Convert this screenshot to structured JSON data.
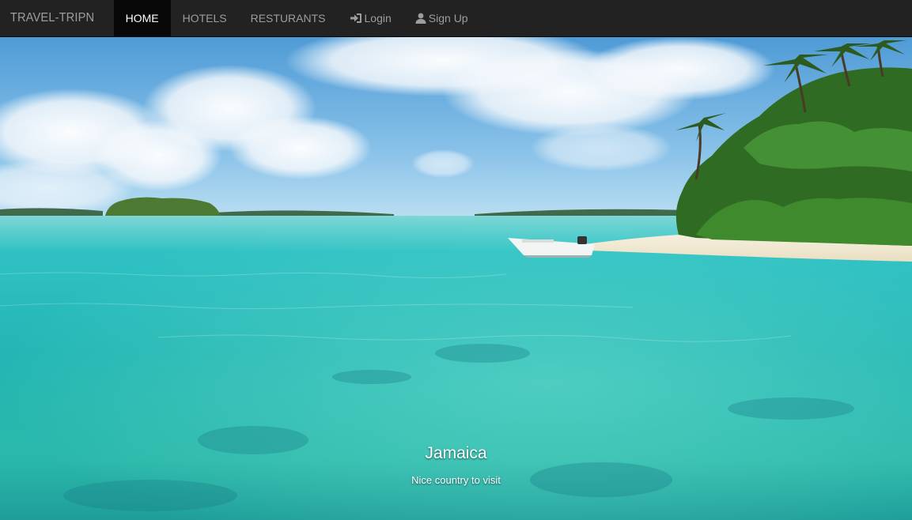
{
  "navbar": {
    "brand": "TRAVEL-TRIPN",
    "items": [
      {
        "label": "HOME",
        "active": true
      },
      {
        "label": "HOTELS",
        "active": false
      },
      {
        "label": "RESTURANTS",
        "active": false
      },
      {
        "label": "Login",
        "icon": "login-icon",
        "active": false
      },
      {
        "label": "Sign Up",
        "icon": "user-icon",
        "active": false
      }
    ]
  },
  "carousel": {
    "slide_title": "Jamaica",
    "slide_caption": "Nice country to visit"
  },
  "colors": {
    "navbar_bg": "#222222",
    "active_bg": "#080808",
    "nav_text": "#9d9d9d"
  }
}
